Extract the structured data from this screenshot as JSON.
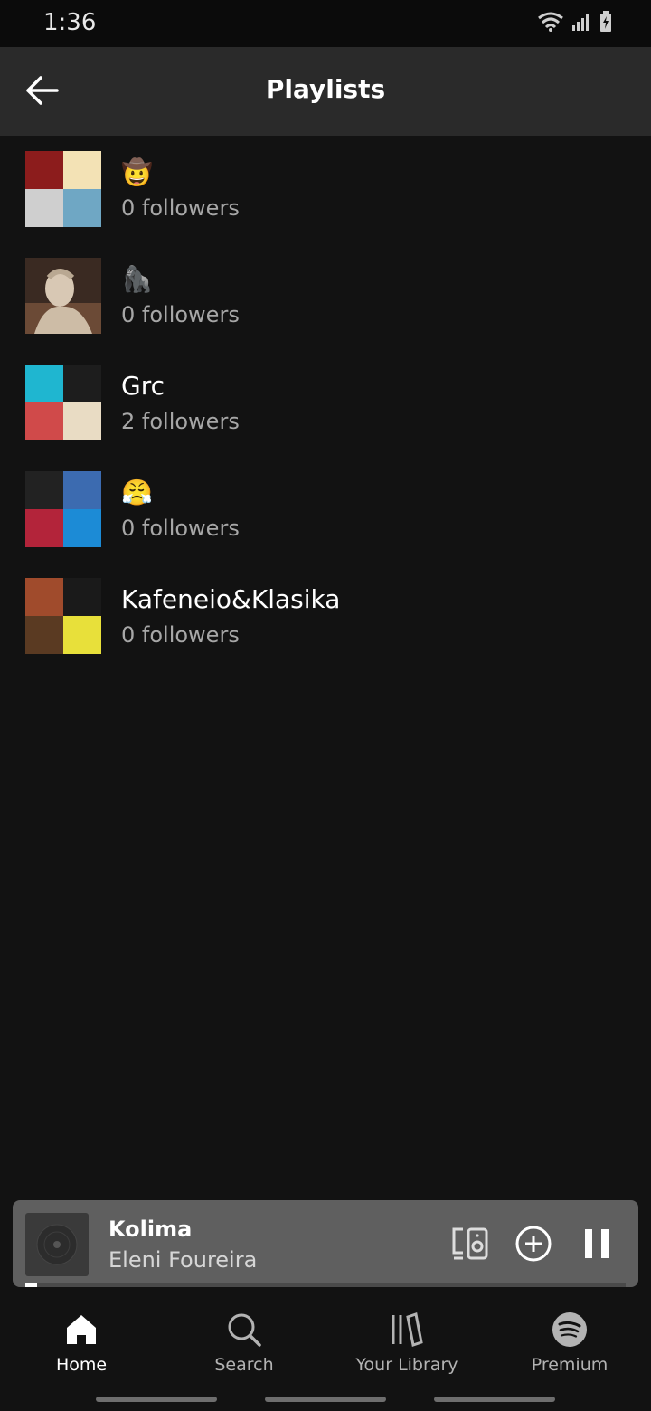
{
  "status_bar": {
    "time": "1:36"
  },
  "header": {
    "title": "Playlists"
  },
  "playlists": [
    {
      "name": "🤠",
      "followers": "0 followers",
      "cover": "mosaic",
      "tiles": [
        "#8c1c1c",
        "#f3e2b5",
        "#cfcfcf",
        "#6fa7c4"
      ]
    },
    {
      "name": "🦍",
      "followers": "0 followers",
      "cover": "single",
      "tiles": [
        "#7a5a44"
      ]
    },
    {
      "name": "Grc",
      "followers": "2 followers",
      "cover": "mosaic",
      "tiles": [
        "#1fb6d0",
        "#1d1d1d",
        "#d04a4a",
        "#e9dcc4"
      ]
    },
    {
      "name": "😤",
      "followers": "0 followers",
      "cover": "mosaic",
      "tiles": [
        "#222222",
        "#3c6bb0",
        "#b3243a",
        "#1c8bd6"
      ]
    },
    {
      "name": "Kafeneio&Klasika",
      "followers": "0 followers",
      "cover": "mosaic",
      "tiles": [
        "#a04b2c",
        "#1a1a1a",
        "#5a3a22",
        "#e8e03a"
      ]
    }
  ],
  "now_playing": {
    "title": "Kolima",
    "artist": "Eleni Foureira",
    "progress": 0.02
  },
  "nav": [
    {
      "label": "Home",
      "icon": "home-icon",
      "active": true
    },
    {
      "label": "Search",
      "icon": "search-icon",
      "active": false
    },
    {
      "label": "Your Library",
      "icon": "library-icon",
      "active": false
    },
    {
      "label": "Premium",
      "icon": "spotify-icon",
      "active": false
    }
  ],
  "colors": {
    "background": "#121212",
    "header": "#2a2a2a",
    "mini_player": "#5f5f5f",
    "secondary_text": "#a7a7a7"
  }
}
